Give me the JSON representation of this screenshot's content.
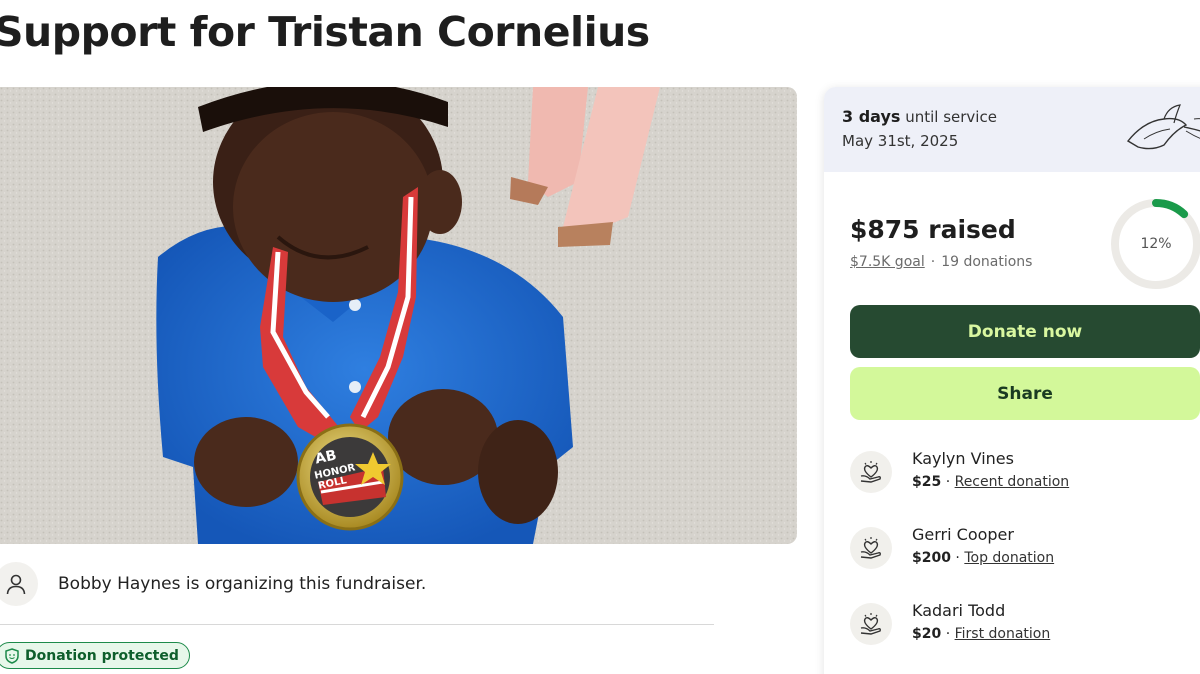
{
  "page": {
    "title": "Support for Tristan Cornelius"
  },
  "hero": {
    "medal_line1": "AB",
    "medal_line2": "HONOR",
    "medal_line3": "ROLL"
  },
  "organizer": {
    "text": "Bobby Haynes is organizing this fundraiser.",
    "avatar_icon": "person-icon"
  },
  "badge": {
    "label": "Donation protected",
    "icon": "shield-icon",
    "color": "#1d8a4a"
  },
  "service": {
    "days": "3 days",
    "until_text": "until service",
    "date": "May 31st, 2025",
    "icon": "lily-flower-icon"
  },
  "fundraiser": {
    "raised": "$875 raised",
    "goal": "$7.5K goal",
    "separator": "·",
    "donations": "19 donations",
    "progress_label": "12%",
    "progress_fraction": 0.12
  },
  "buttons": {
    "donate": "Donate now",
    "share": "Share",
    "donate_color": "#264a31",
    "share_color": "#d3f89a"
  },
  "donations": [
    {
      "name": "Kaylyn Vines",
      "amount": "$25",
      "dot": "·",
      "tag": "Recent donation",
      "icon": "heart-hand-icon"
    },
    {
      "name": "Gerri Cooper",
      "amount": "$200",
      "dot": "·",
      "tag": "Top donation",
      "icon": "heart-hand-icon"
    },
    {
      "name": "Kadari Todd",
      "amount": "$20",
      "dot": "·",
      "tag": "First donation",
      "icon": "heart-hand-icon"
    }
  ]
}
